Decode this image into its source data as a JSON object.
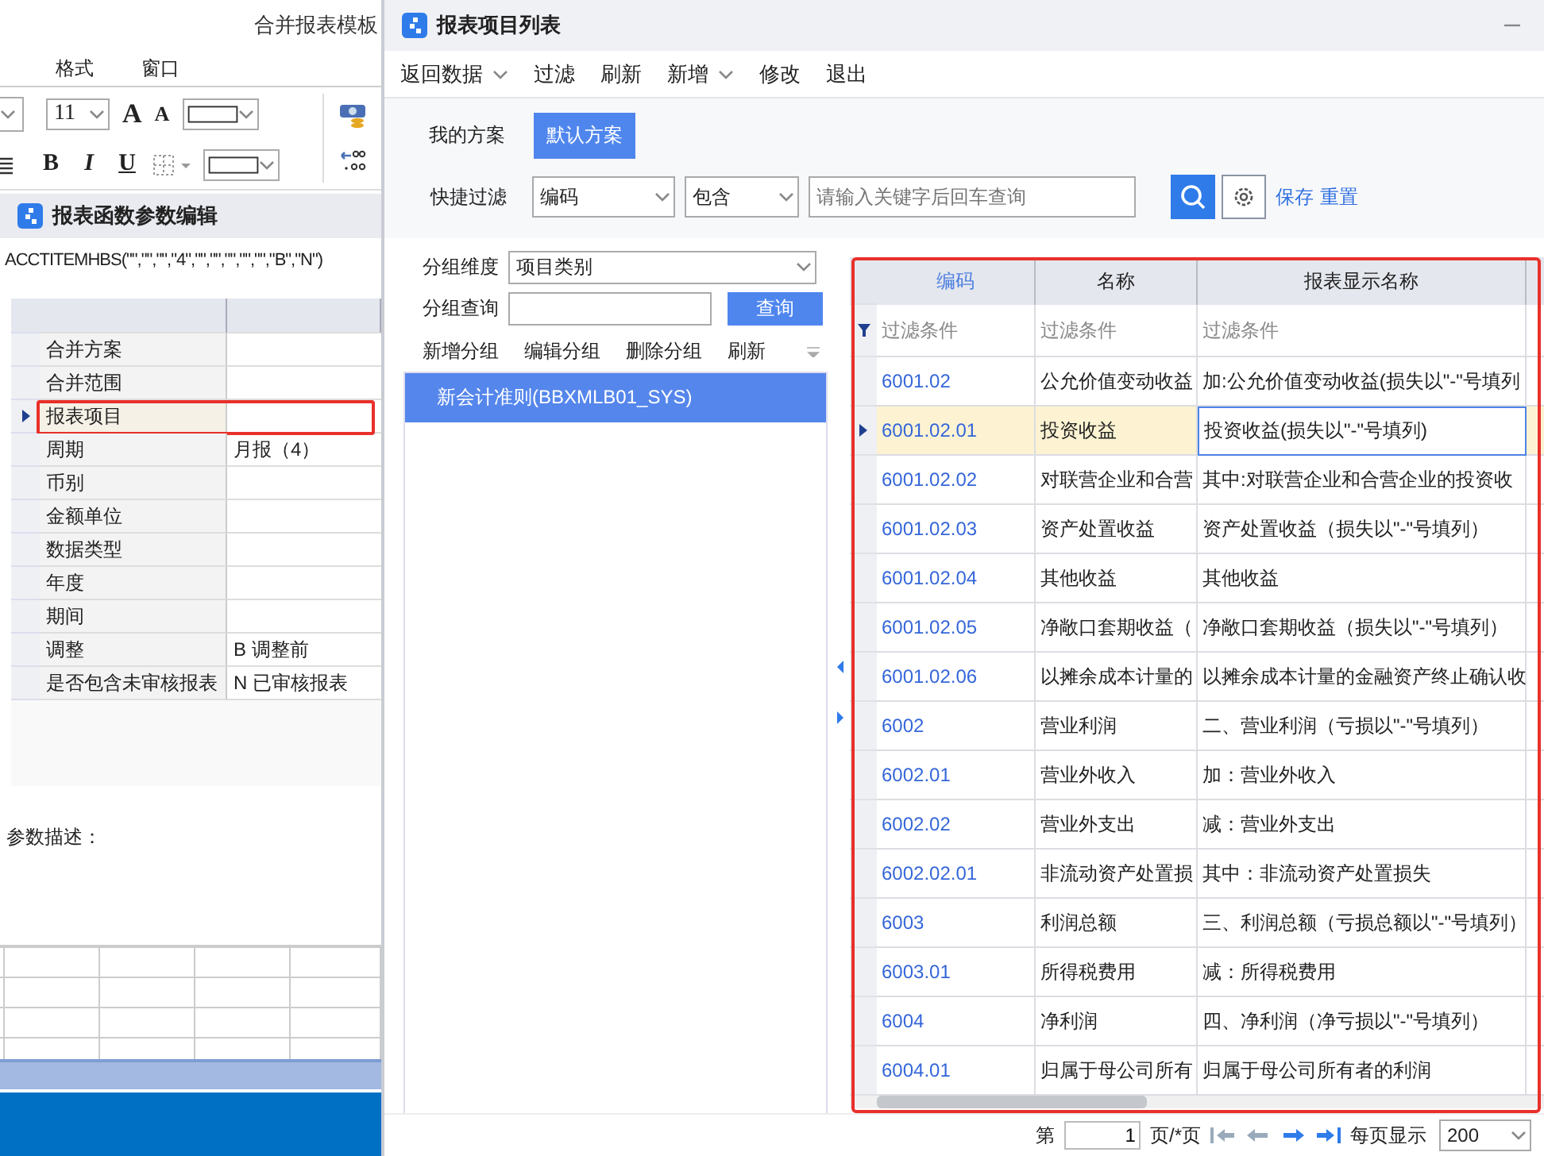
{
  "background_app": {
    "title": "合并报表模板",
    "menu": [
      "格式",
      "窗口"
    ],
    "toolbar": {
      "font_size": "11",
      "size_buttons": [
        {
          "label": "A",
          "kind": "grow"
        },
        {
          "label": "A",
          "kind": "shrink"
        }
      ],
      "style_buttons": [
        {
          "label": "B",
          "kind": "bold"
        },
        {
          "label": "I",
          "kind": "italic"
        },
        {
          "label": "U",
          "kind": "underline"
        }
      ]
    },
    "formula_panel": {
      "title": "报表函数参数编辑",
      "formula": "ACCTITEMHBS(\"\",\"\",\"\",\"4\",\"\",\"\",\"\",\"\",\"\",\"B\",\"N\")",
      "highlighted": true,
      "params": [
        {
          "name": "合并方案",
          "selected": false
        },
        {
          "name": "合并范围",
          "selected": false
        },
        {
          "name": "报表项目",
          "selected": true
        },
        {
          "name": "周期",
          "value": "月报（4）",
          "selected": false
        },
        {
          "name": "币别",
          "selected": false
        },
        {
          "name": "金额单位",
          "selected": false
        },
        {
          "name": "数据类型",
          "selected": false
        },
        {
          "name": "年度",
          "selected": false
        },
        {
          "name": "期间",
          "selected": false
        },
        {
          "name": "调整",
          "value": "B  调整前",
          "selected": false
        },
        {
          "name": "是否包含未审核报表",
          "value": "N  已审核报表",
          "selected": false
        }
      ],
      "description_label": "参数描述："
    }
  },
  "dialog": {
    "title": "报表项目列表",
    "menu": [
      {
        "label": "返回数据",
        "dropdown": true
      },
      {
        "label": "过滤",
        "dropdown": false
      },
      {
        "label": "刷新",
        "dropdown": false
      },
      {
        "label": "新增",
        "dropdown": true
      },
      {
        "label": "修改",
        "dropdown": false
      },
      {
        "label": "退出",
        "dropdown": false
      }
    ],
    "schemes": [
      {
        "label": "我的方案",
        "selected": false
      },
      {
        "label": "默认方案",
        "selected": true
      }
    ],
    "quick_filter": {
      "label": "快捷过滤",
      "field": "编码",
      "operator": "包含",
      "placeholder": "请输入关键字后回车查询",
      "links": [
        "保存",
        "重置"
      ]
    },
    "groups": {
      "dimension_label": "分组维度",
      "dimension": "项目类别",
      "query_label": "分组查询",
      "query_button": "查询",
      "actions": [
        "新增分组",
        "编辑分组",
        "删除分组",
        "刷新"
      ],
      "items": [
        {
          "label": "新会计准则(BBXMLB01_SYS)",
          "selected": true
        }
      ]
    },
    "grid": {
      "highlighted": true,
      "columns": [
        {
          "title": "编码",
          "sorted": true,
          "filter": "过滤条件"
        },
        {
          "title": "名称",
          "sorted": false,
          "filter": "过滤条件"
        },
        {
          "title": "报表显示名称",
          "sorted": false,
          "filter": "过滤条件"
        }
      ],
      "rows": [
        {
          "code": "6001.02",
          "name": "公允价值变动收益",
          "display": "加:公允价值变动收益(损失以\"-\"号填列",
          "selected": false
        },
        {
          "code": "6001.02.01",
          "name": "投资收益",
          "display": "投资收益(损失以\"-\"号填列)",
          "selected": true
        },
        {
          "code": "6001.02.02",
          "name": "对联营企业和合营",
          "display": "其中:对联营企业和合营企业的投资收",
          "selected": false
        },
        {
          "code": "6001.02.03",
          "name": "资产处置收益",
          "display": "资产处置收益（损失以\"-\"号填列）",
          "selected": false
        },
        {
          "code": "6001.02.04",
          "name": "其他收益",
          "display": "其他收益",
          "selected": false
        },
        {
          "code": "6001.02.05",
          "name": "净敞口套期收益（",
          "display": "净敞口套期收益（损失以\"-\"号填列）",
          "selected": false
        },
        {
          "code": "6001.02.06",
          "name": "以摊余成本计量的",
          "display": "以摊余成本计量的金融资产终止确认收",
          "selected": false
        },
        {
          "code": "6002",
          "name": "营业利润",
          "display": "二、营业利润（亏损以\"-\"号填列）",
          "selected": false
        },
        {
          "code": "6002.01",
          "name": "营业外收入",
          "display": "加：营业外收入",
          "selected": false
        },
        {
          "code": "6002.02",
          "name": "营业外支出",
          "display": "减：营业外支出",
          "selected": false
        },
        {
          "code": "6002.02.01",
          "name": "非流动资产处置损",
          "display": "其中：非流动资产处置损失",
          "selected": false
        },
        {
          "code": "6003",
          "name": "利润总额",
          "display": "三、利润总额（亏损总额以\"-\"号填列）",
          "selected": false
        },
        {
          "code": "6003.01",
          "name": "所得税费用",
          "display": "减：所得税费用",
          "selected": false
        },
        {
          "code": "6004",
          "name": "净利润",
          "display": "四、净利润（净亏损以\"-\"号填列）",
          "selected": false
        },
        {
          "code": "6004.01",
          "name": "归属于母公司所有",
          "display": "归属于母公司所有者的利润",
          "selected": false
        }
      ]
    },
    "pager": {
      "prefix": "第",
      "page": "1",
      "suffix": "页/*页",
      "per_page_label": "每页显示",
      "per_page": "200"
    }
  }
}
